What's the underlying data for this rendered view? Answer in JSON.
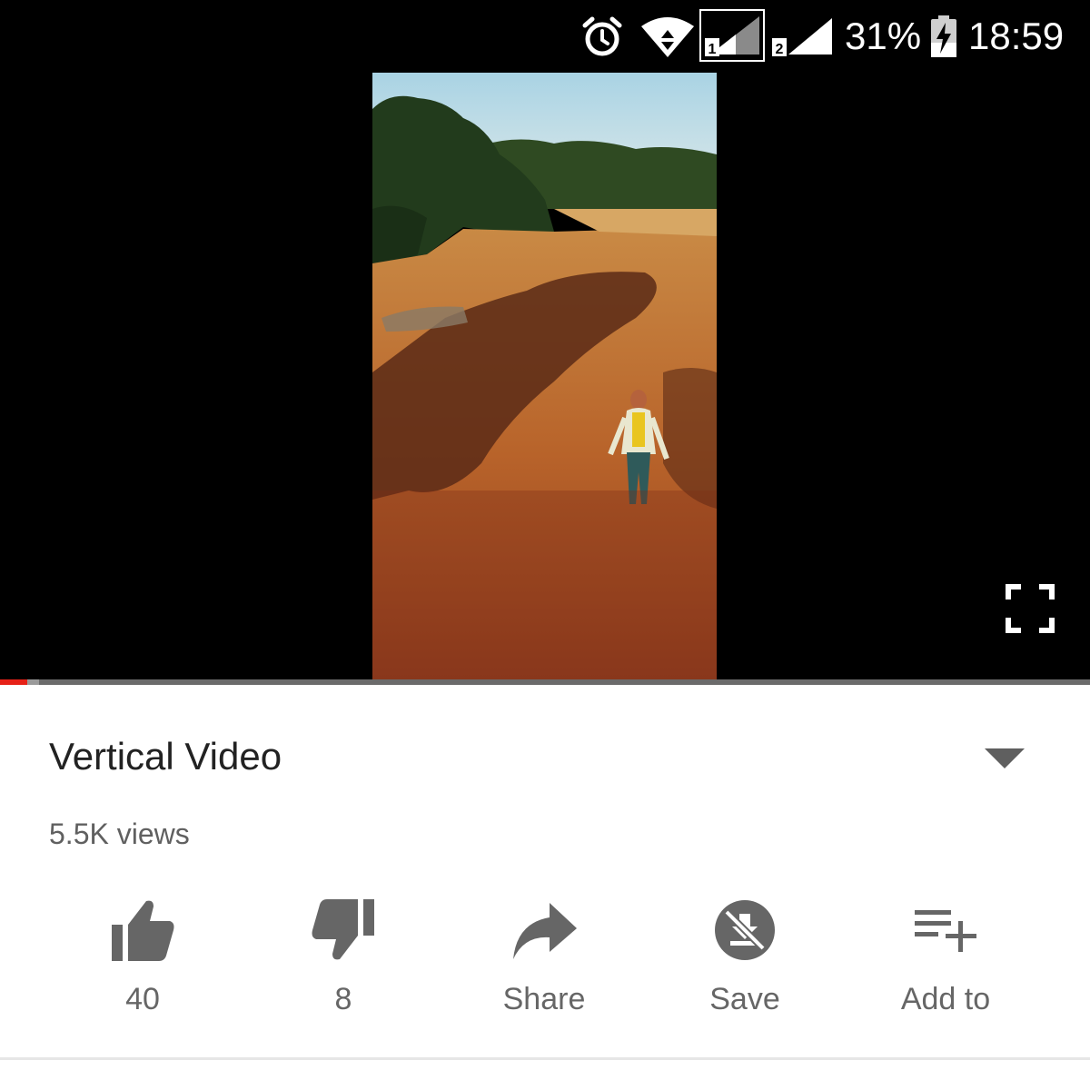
{
  "status_bar": {
    "battery_percent": "31%",
    "time": "18:59",
    "icons": [
      "alarm-icon",
      "wifi-icon",
      "signal-sim1-icon",
      "signal-sim2-icon",
      "battery-charging-icon"
    ],
    "sim1_label": "1",
    "sim2_label": "2"
  },
  "player": {
    "progress_fraction": 0.025,
    "buffer_fraction": 0.036,
    "progress_color": "#e62117",
    "fullscreen_icon": "fullscreen-icon"
  },
  "video": {
    "title": "Vertical Video",
    "views": "5.5K views"
  },
  "actions": [
    {
      "id": "like",
      "icon": "thumbs-up-icon",
      "label": "40"
    },
    {
      "id": "dislike",
      "icon": "thumbs-down-icon",
      "label": "8"
    },
    {
      "id": "share",
      "icon": "share-icon",
      "label": "Share"
    },
    {
      "id": "save",
      "icon": "save-offline-icon",
      "label": "Save"
    },
    {
      "id": "add-to",
      "icon": "playlist-add-icon",
      "label": "Add to"
    }
  ]
}
